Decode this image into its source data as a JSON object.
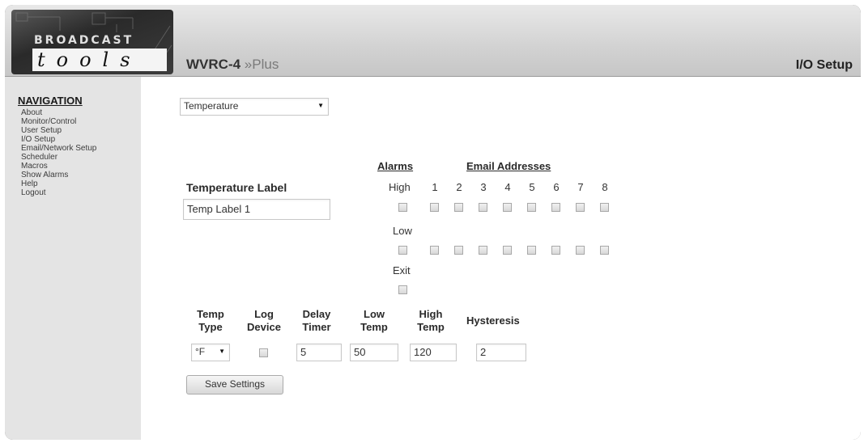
{
  "brand": {
    "line1": "BROADCAST",
    "line2": "tools"
  },
  "header": {
    "model": "WVRC-4",
    "model_suffix": "Plus",
    "section_title": "I/O Setup"
  },
  "nav": {
    "title": "NAVIGATION",
    "items": [
      "About",
      "Monitor/Control",
      "User Setup",
      "I/O Setup",
      "Email/Network Setup",
      "Scheduler",
      "Macros",
      "Show Alarms",
      "Help",
      "Logout"
    ]
  },
  "form": {
    "type_select": "Temperature",
    "label_heading": "Temperature Label",
    "label_value": "Temp Label 1",
    "alarms_heading": "Alarms",
    "email_heading": "Email Addresses",
    "email_numbers": [
      "1",
      "2",
      "3",
      "4",
      "5",
      "6",
      "7",
      "8"
    ],
    "rows": {
      "high": "High",
      "low": "Low",
      "exit": "Exit"
    },
    "columns": {
      "temp_type": "Temp Type",
      "log_device": "Log Device",
      "delay_timer": "Delay Timer",
      "low_temp": "Low Temp",
      "high_temp": "High Temp",
      "hysteresis": "Hysteresis"
    },
    "values": {
      "temp_type": "°F",
      "delay_timer": "5",
      "low_temp": "50",
      "high_temp": "120",
      "hysteresis": "2"
    },
    "save_label": "Save Settings"
  }
}
